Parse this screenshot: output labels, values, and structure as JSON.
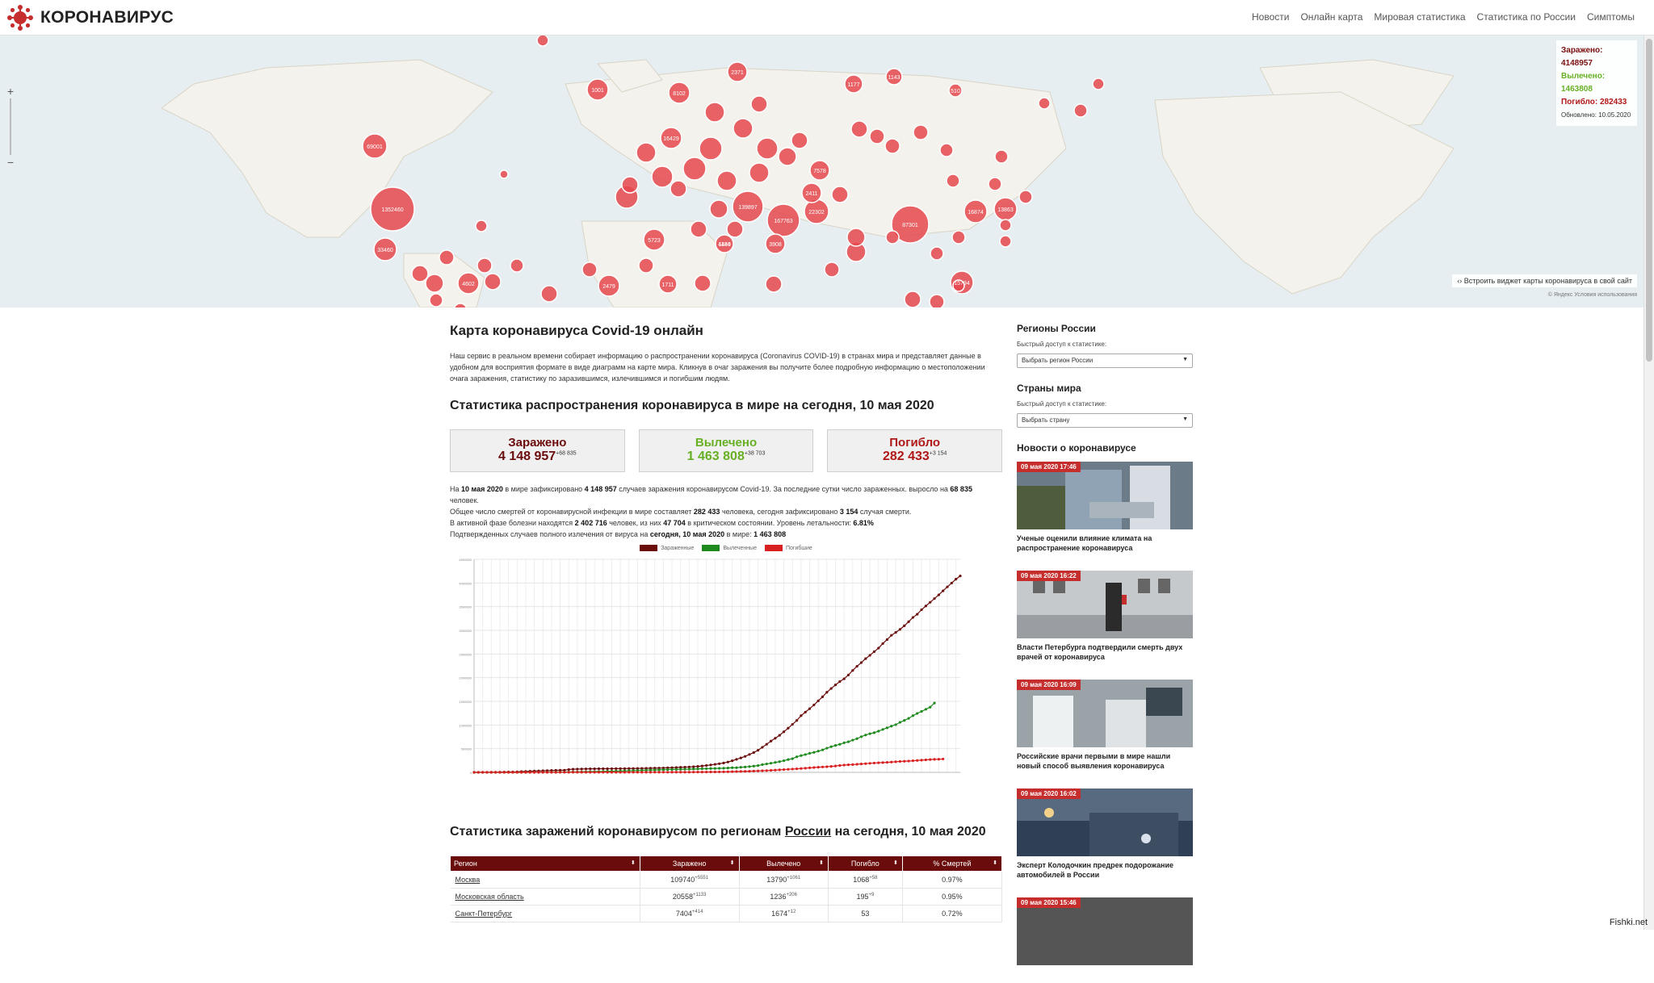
{
  "header": {
    "logo_text": "КОРОНАВИРУС",
    "nav": [
      "Новости",
      "Онлайн карта",
      "Мировая статистика",
      "Статистика по России",
      "Симптомы"
    ]
  },
  "map": {
    "stats": {
      "infected": "Заражено: 4148957",
      "recovered": "Вылечено: 1463808",
      "dead": "Погибло: 282433",
      "updated": "Обновлено: 10.05.2020"
    },
    "embed_text": "Встроить виджет карты коронавируса в свой сайт",
    "copyright": "© Яндекс Условия использования",
    "zoom_in": "+",
    "zoom_out": "−",
    "bubble_labels": [
      "1352460",
      "69001",
      "33460",
      "1001",
      "8102",
      "2371",
      "1177",
      "1143",
      "510",
      "16429",
      "167763",
      "139897",
      "87301",
      "13863",
      "16874",
      "15794",
      "7578",
      "2411",
      "5723",
      "4440",
      "3908",
      "2479",
      "1184",
      "1711",
      "4602",
      "22302"
    ]
  },
  "main": {
    "title": "Карта коронавируса Covid-19 онлайн",
    "intro": "Наш сервис в реальном времени собирает информацию о распространении коронавируса (Coronavirus COVID-19) в странах мира и представляет данные в удобном для восприятия формате в виде диаграмм на карте мира. Кликнув в очаг заражения вы получите более подробную информацию о местоположении очага заражения, статистику по заразившимся, излечившимся и погибшим людям.",
    "stats_title": "Статистика распространения коронавируса в мире на сегодня, 10 мая 2020",
    "cards": {
      "infected": {
        "label": "Заражено",
        "value": "4 148 957",
        "delta": "+68 835"
      },
      "recovered": {
        "label": "Вылечено",
        "value": "1 463 808",
        "delta": "+38 703"
      },
      "dead": {
        "label": "Погибло",
        "value": "282 433",
        "delta": "+3 154"
      }
    },
    "summary": {
      "l1a": "На ",
      "l1b": "10 мая 2020",
      "l1c": " в мире зафиксировано ",
      "l1d": "4 148 957",
      "l1e": " случаев заражения коронавирусом Covid-19. За последние сутки число зараженных. выросло на ",
      "l1f": "68 835",
      "l1g": " человек.",
      "l2a": "Общее число смертей от коронавирусной инфекции в мире составляет ",
      "l2b": "282 433",
      "l2c": " человека, сегодня зафиксировано ",
      "l2d": "3 154",
      "l2e": " случая смерти.",
      "l3a": "В активной фазе болезни находятся ",
      "l3b": "2 402 716",
      "l3c": " человек, из них ",
      "l3d": "47 704",
      "l3e": " в критическом состоянии. Уровень летальности: ",
      "l3f": "6.81%",
      "l4a": "Подтвержденных случаев полного излечения от вируса на ",
      "l4b": "сегодня, 10 мая 2020",
      "l4c": " в мире: ",
      "l4d": "1 463 808"
    },
    "legend": [
      "Зараженные",
      "Вылеченные",
      "Погибшие"
    ],
    "regions_title_a": "Статистика заражений коронавирусом по регионам ",
    "regions_title_link": "России",
    "regions_title_b": " на сегодня, 10 мая 2020",
    "table": {
      "headers": [
        "Регион",
        "Заражено",
        "Вылечено",
        "Погибло",
        "% Смертей"
      ],
      "rows": [
        {
          "region": "Москва",
          "inf": "109740",
          "inf_d": "+5551",
          "rec": "13790",
          "rec_d": "+1061",
          "dead": "1068",
          "dead_d": "+58",
          "pct": "0.97%"
        },
        {
          "region": "Московская область",
          "inf": "20558",
          "inf_d": "+1133",
          "rec": "1236",
          "rec_d": "+206",
          "dead": "195",
          "dead_d": "+9",
          "pct": "0.95%"
        },
        {
          "region": "Санкт-Петербург",
          "inf": "7404",
          "inf_d": "+414",
          "rec": "1674",
          "rec_d": "+12",
          "dead": "53",
          "dead_d": "",
          "pct": "0.72%"
        }
      ]
    }
  },
  "sidebar": {
    "regions_title": "Регионы России",
    "regions_hint": "Быстрый доступ к статистике:",
    "regions_select": "Выбрать регион России",
    "countries_title": "Страны мира",
    "countries_hint": "Быстрый доступ к статистике:",
    "countries_select": "Выбрать страну",
    "news_title": "Новости о коронавирусе",
    "news": [
      {
        "date": "09 мая 2020 17:46",
        "title": "Ученые оценили влияние климата на распространение коронавируса"
      },
      {
        "date": "09 мая 2020 16:22",
        "title": "Власти Петербурга подтвердили смерть двух врачей от коронавируса"
      },
      {
        "date": "09 мая 2020 16:09",
        "title": "Российские врачи первыми в мире нашли новый способ выявления коронавируса"
      },
      {
        "date": "09 мая 2020 16:02",
        "title": "Эксперт Колодочкин предрек подорожание автомобилей в России"
      },
      {
        "date": "09 мая 2020 15:46",
        "title": ""
      }
    ]
  },
  "watermark": "Fishki.net",
  "colors": {
    "infected": "#6b0c0c",
    "recovered": "#1e8a1e",
    "dead": "#d92020",
    "brand": "#c62d2d"
  },
  "chart_data": {
    "type": "line",
    "title": "",
    "xlabel": "",
    "ylabel": "",
    "ylim": [
      0,
      4500000
    ],
    "y_ticks": [
      "0",
      "500000",
      "1000000",
      "1500000",
      "2000000",
      "2500000",
      "3000000",
      "3500000",
      "4000000",
      "4500000"
    ],
    "x_points": 108,
    "series": [
      {
        "name": "Зараженные",
        "color": "#6b0c0c",
        "values": [
          555,
          654,
          941,
          1434,
          2118,
          2927,
          5578,
          6166,
          8234,
          9927,
          12038,
          16787,
          19881,
          23892,
          27635,
          30794,
          34391,
          37120,
          40150,
          42762,
          44802,
          45221,
          60368,
          66885,
          69030,
          71224,
          73258,
          75136,
          75639,
          76197,
          76823,
          77206,
          78166,
          78599,
          78985,
          79570,
          80415,
          81397,
          82756,
          84124,
          85403,
          87137,
          88948,
          90869,
          93091,
          95324,
          98192,
          102050,
          106099,
          109991,
          114381,
          118948,
          126214,
          134576,
          145483,
          156653,
          169593,
          182490,
          198234,
          218815,
          244933,
          275597,
          305036,
          337489,
          378287,
          418045,
          467653,
          529591,
          593291,
          660706,
          720117,
          782365,
          857487,
          932605,
          1013320,
          1095917,
          1197408,
          1272115,
          1345048,
          1424479,
          1511104,
          1595350,
          1691719,
          1771514,
          1846680,
          1917319,
          1976192,
          2056054,
          2152437,
          2240190,
          2317758,
          2401379,
          2472259,
          2549294,
          2624004,
          2719897,
          2804796,
          2894557,
          2955694,
          3018952,
          3095582,
          3181658,
          3271932,
          3339432,
          3434434,
          3514315,
          3591326,
          3670436,
          3748576,
          3834117,
          3917366,
          3998245,
          4080044,
          4148957
        ]
      },
      {
        "name": "Вылеченные",
        "color": "#1e8a1e",
        "values": [
          28,
          30,
          36,
          39,
          52,
          61,
          107,
          126,
          143,
          222,
          284,
          472,
          623,
          852,
          1124,
          1487,
          2011,
          2616,
          3244,
          3946,
          4683,
          5150,
          6295,
          8058,
          9395,
          10865,
          12583,
          14352,
          16121,
          18177,
          18890,
          22886,
          23394,
          25227,
          27905,
          30384,
          33277,
          36711,
          39782,
          42716,
          45602,
          48228,
          51170,
          53796,
          55866,
          58359,
          60695,
          62494,
          64404,
          67003,
          68324,
          70251,
          72624,
          76034,
          78088,
          80840,
          83207,
          84854,
          87256,
          91676,
          97704,
          98334,
          108000,
          113787,
          122150,
          132440,
          142175,
          164566,
          178034,
          193177,
          210263,
          225796,
          246152,
          270372,
          288456,
          328661,
          353975,
          376096,
          402110,
          421722,
          448655,
          474261,
          510330,
          542107,
          568343,
          592319,
          623903,
          645738,
          681007,
          711652,
          753327,
          789014,
          816385,
          837440,
          870113,
          906988,
          940282,
          976223,
          1007000,
          1056425,
          1096934,
          1140046,
          1198000,
          1244834,
          1287040,
          1332612,
          1377000,
          1463808
        ]
      },
      {
        "name": "Погибшие",
        "color": "#d92020",
        "values": [
          17,
          18,
          26,
          42,
          56,
          82,
          131,
          133,
          171,
          213,
          259,
          362,
          426,
          492,
          564,
          634,
          719,
          806,
          906,
          1013,
          1113,
          1118,
          1371,
          1523,
          1666,
          1770,
          1868,
          2007,
          2122,
          2247,
          2251,
          2458,
          2469,
          2629,
          2708,
          2770,
          2814,
          2872,
          2941,
          2996,
          3085,
          3160,
          3254,
          3348,
          3460,
          3558,
          3802,
          3988,
          4262,
          4615,
          4720,
          5404,
          5819,
          6440,
          7126,
          7905,
          8733,
          9867,
          11299,
          12973,
          14623,
          16497,
          18615,
          21181,
          23970,
          27198,
          30652,
          33925,
          37582,
          42107,
          47245,
          53190,
          58787,
          64606,
          69374,
          74565,
          81865,
          88338,
          95455,
          102525,
          108502,
          114090,
          119483,
          125983,
          134178,
          145521,
          153822,
          159510,
          165069,
          170423,
          177641,
          184217,
          191061,
          197246,
          202846,
          206544,
          211167,
          217153,
          224172,
          230890,
          234112,
          238650,
          244664,
          251537,
          257239,
          263831,
          270426,
          274898,
          277432,
          282433
        ]
      }
    ]
  }
}
